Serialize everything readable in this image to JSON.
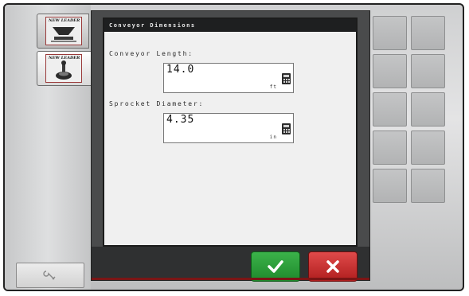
{
  "side_tabs": [
    {
      "brand": "NEW LEADER",
      "icon": "spreader-icon"
    },
    {
      "brand": "NEW LEADER",
      "icon": "joystick-icon"
    }
  ],
  "tools_button": {
    "icon": "wrench-icon"
  },
  "dialog": {
    "title": "Conveyor Dimensions",
    "fields": [
      {
        "label": "Conveyor Length:",
        "value": "14.0",
        "unit": "ft"
      },
      {
        "label": "Sprocket Diameter:",
        "value": "4.35",
        "unit": "in"
      }
    ]
  },
  "actions": {
    "confirm_icon": "checkmark-icon",
    "cancel_icon": "close-icon",
    "confirm_color": "#2a9b39",
    "cancel_color": "#c92828"
  },
  "softkeys": {
    "count": 10
  }
}
